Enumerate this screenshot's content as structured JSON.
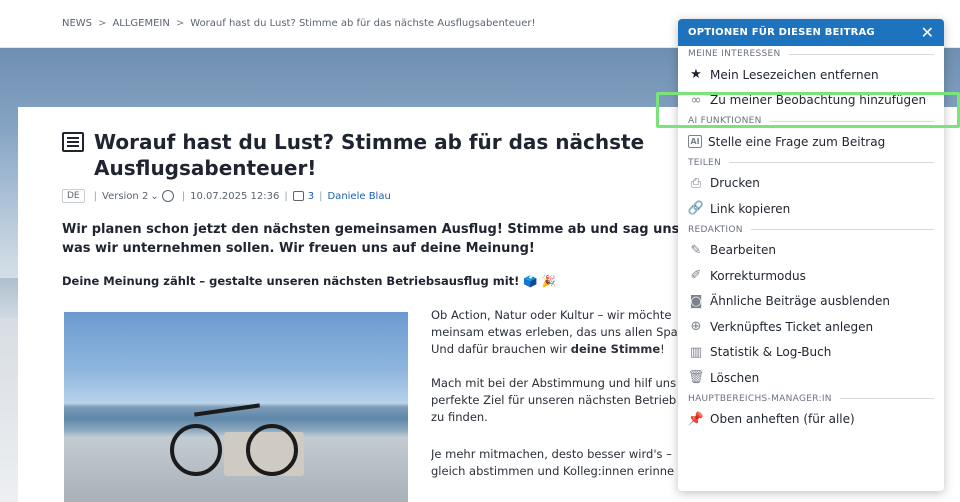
{
  "breadcrumb": {
    "items": [
      "NEWS",
      "ALLGEMEIN",
      "Worauf hast du Lust? Stimme ab für das nächste Ausflugsabenteuer!"
    ],
    "separator": ">"
  },
  "article": {
    "title": "Worauf hast du Lust? Stimme ab für das nächste Ausflugsabenteuer!",
    "meta": {
      "language": "DE",
      "version": "Version 2",
      "date": "10.07.2025 12:36",
      "comments": "3",
      "author": "Daniele Blau"
    },
    "lead": "Wir planen schon jetzt den nächsten gemeinsamen Ausflug! Stimme ab und sag uns, was wir unternehmen sollen. Wir freuen uns auf deine Meinung!",
    "subhead": "Deine Meinung zählt – gestalte unseren nächsten Betriebsausflug mit! 🗳️ 🎉",
    "paragraphs": [
      [
        "Ob Action, Natur oder Kultur – wir möchte",
        "meinsam etwas erleben, das uns allen Spa",
        "Und dafür brauchen wir "
      ],
      [
        "Mach mit bei der Abstimmung und hilf uns",
        "perfekte Ziel für unseren nächsten Betrieb",
        "zu finden."
      ],
      [
        "Je mehr mitmachen, desto besser wird's –",
        "gleich abstimmen und Kolleg:innen erinne"
      ]
    ],
    "bold_phrase": "deine Stimme",
    "bold_suffix": "!"
  },
  "panel": {
    "title": "OPTIONEN FÜR DIESEN BEITRAG",
    "close": "✕",
    "sections": [
      {
        "label": "MEINE INTERESSEN",
        "items": [
          {
            "label": "Mein Lesezeichen entfernen",
            "icon": "star-remove-icon",
            "glyph": "★"
          },
          {
            "label": "Zu meiner Beobachtung hinzufügen",
            "icon": "binoculars-icon",
            "glyph": "∞"
          }
        ]
      },
      {
        "label": "AI FUNKTIONEN",
        "items": [
          {
            "label": "Stelle eine Frage zum Beitrag",
            "icon": "ai-icon",
            "glyph": "AI"
          }
        ]
      },
      {
        "label": "TEILEN",
        "items": [
          {
            "label": "Drucken",
            "icon": "printer-icon",
            "glyph": "⎙"
          },
          {
            "label": "Link kopieren",
            "icon": "link-icon",
            "glyph": "🔗"
          }
        ]
      },
      {
        "label": "REDAKTION",
        "items": [
          {
            "label": "Bearbeiten",
            "icon": "pencil-icon",
            "glyph": "✎"
          },
          {
            "label": "Korrekturmodus",
            "icon": "edit-box-icon",
            "glyph": "✐"
          },
          {
            "label": "Ähnliche Beiträge ausblenden",
            "icon": "hide-similar-icon",
            "glyph": "◙"
          },
          {
            "label": "Verknüpftes Ticket anlegen",
            "icon": "add-circle-icon",
            "glyph": "⊕"
          },
          {
            "label": "Statistik & Log-Buch",
            "icon": "chart-icon",
            "glyph": "▥"
          },
          {
            "label": "Löschen",
            "icon": "trash-icon",
            "glyph": "🗑"
          }
        ]
      },
      {
        "label": "HAUPTBEREICHS-MANAGER:IN",
        "items": [
          {
            "label": "Oben anheften (für alle)",
            "icon": "pin-icon",
            "glyph": "📌"
          }
        ]
      }
    ]
  }
}
